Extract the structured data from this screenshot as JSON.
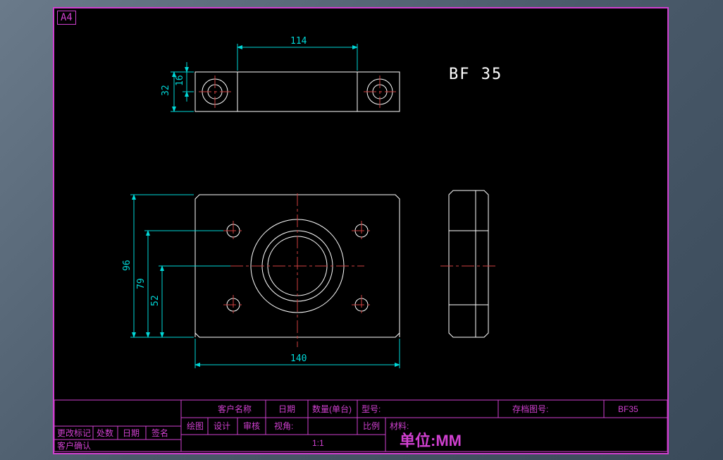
{
  "sheet": {
    "size": "A4"
  },
  "part": {
    "label": "BF 35",
    "archive_no": "BF35"
  },
  "dimensions": {
    "top_width_inner": "114",
    "top_height": "32",
    "top_hole_offset": "16",
    "front_width": "140",
    "front_height": "96",
    "front_bolt_v": "79",
    "front_bore_center": "52"
  },
  "titleblock": {
    "customer_name_lbl": "客户名称",
    "date_lbl": "日期",
    "qty_lbl": "数量(单台)",
    "model_lbl": "型号:",
    "archive_lbl": "存档图号:",
    "material_lbl": "材料:",
    "drawn_lbl": "绘图",
    "design_lbl": "设计",
    "check_lbl": "审核",
    "view_lbl": "视角:",
    "scale_lbl": "比例",
    "scale_val": "1:1",
    "unit_lbl": "单位:MM",
    "rev_mark": "更改标记",
    "rev_cnt": "处数",
    "rev_date": "日期",
    "rev_sign": "签名",
    "cust_confirm": "客户确认"
  }
}
